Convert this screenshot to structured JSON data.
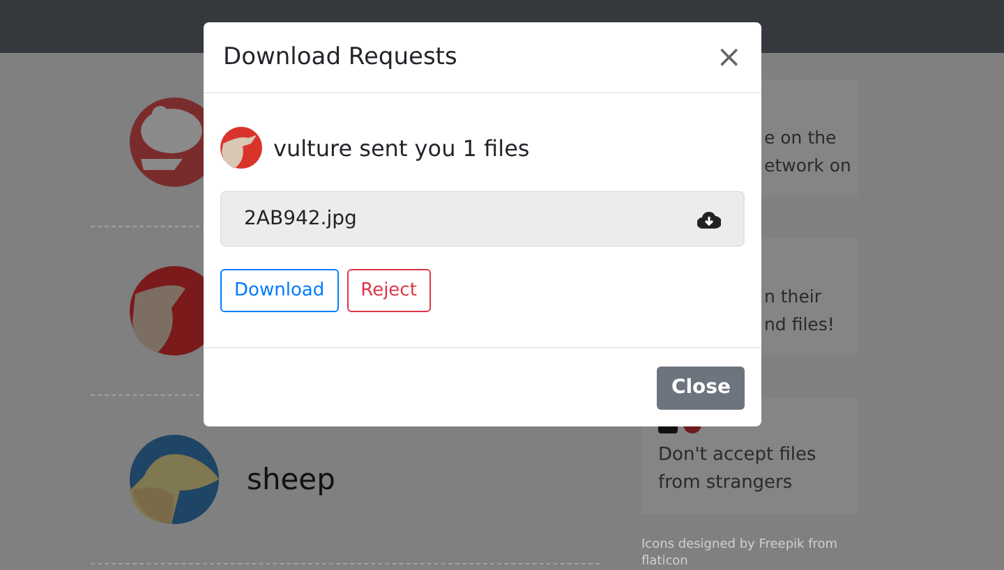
{
  "contacts": [
    {
      "name": "sheep"
    }
  ],
  "tips": [
    {
      "kind": "clipped",
      "lines": [
        "e on the",
        "etwork on"
      ]
    },
    {
      "kind": "clipped",
      "lines": [
        "n their",
        "nd files!"
      ]
    },
    {
      "kind": "full",
      "lines": [
        "Don't accept files",
        "from strangers"
      ]
    }
  ],
  "credit": {
    "lines": [
      "Icons designed by Freepik from",
      "flaticon"
    ]
  },
  "modal": {
    "title": "Download Requests",
    "close": "×",
    "message": "vulture sent you 1 files",
    "files": [
      {
        "name": "2AB942.jpg"
      }
    ],
    "actions": [
      {
        "label": "Download",
        "kind": "primary"
      },
      {
        "label": "Reject",
        "kind": "danger"
      }
    ],
    "footer_button": "Close"
  }
}
